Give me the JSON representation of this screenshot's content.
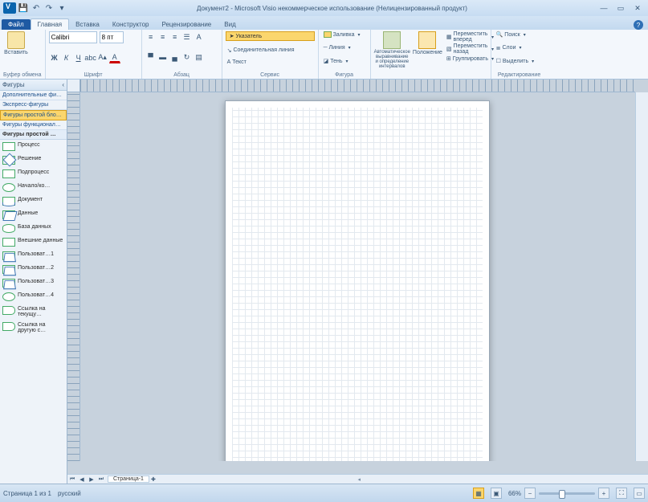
{
  "title": "Документ2 - Microsoft Visio некоммерческое использование (Нелицензированный продукт)",
  "qat": {
    "save": "💾",
    "undo": "↶",
    "redo": "↷",
    "more": "▾"
  },
  "wc": {
    "min": "—",
    "max": "▭",
    "close": "✕"
  },
  "tabs": {
    "file": "Файл",
    "items": [
      "Главная",
      "Вставка",
      "Конструктор",
      "Рецензирование",
      "Вид"
    ],
    "active": 0
  },
  "ribbon": {
    "clipboard": {
      "label": "Буфер обмена",
      "paste": "Вставить"
    },
    "font": {
      "label": "Шрифт",
      "name": "Calibri",
      "size": "8 пт"
    },
    "para": {
      "label": "Абзац"
    },
    "tools": {
      "label": "Сервис",
      "pointer": "Указатель",
      "connector": "Соединительная линия",
      "text": "Текст"
    },
    "shape": {
      "label": "Фигура",
      "fill": "Заливка",
      "line": "Линия",
      "shadow": "Тень"
    },
    "arrange": {
      "label": "",
      "auto": "Автоматическое выравнивание и определение интервалов",
      "position": "Положение",
      "front": "Переместить вперед",
      "back": "Переместить назад",
      "group": "Группировать"
    },
    "edit": {
      "label": "Редактирование",
      "find": "Поиск",
      "layers": "Слои",
      "select": "Выделить"
    }
  },
  "shapes": {
    "title": "Фигуры",
    "sections": [
      "Дополнительные фи…",
      "Экспресс-фигуры",
      "Фигуры простой бло…",
      "Фигуры функционал…"
    ],
    "activeSection": 2,
    "header": "Фигуры простой …",
    "items": [
      {
        "g": "g-rect",
        "label": "Процесс"
      },
      {
        "g": "g-diam",
        "label": "Решение"
      },
      {
        "g": "g-rect",
        "label": "Подпроцесс"
      },
      {
        "g": "g-ell",
        "label": "Начало/ко…"
      },
      {
        "g": "g-doc",
        "label": "Документ"
      },
      {
        "g": "g-para",
        "label": "Данные"
      },
      {
        "g": "g-db",
        "label": "База данных"
      },
      {
        "g": "g-rect",
        "label": "Внешние данные"
      },
      {
        "g": "g-trap",
        "label": "Пользоват…1"
      },
      {
        "g": "g-trap",
        "label": "Пользоват…2"
      },
      {
        "g": "g-trap",
        "label": "Пользоват…3"
      },
      {
        "g": "g-ell",
        "label": "Пользоват…4"
      },
      {
        "g": "g-tag",
        "label": "Ссылка на текущу…"
      },
      {
        "g": "g-tag",
        "label": "Ссылка на другую с…"
      }
    ]
  },
  "pagetab": {
    "label": "Страница-1"
  },
  "status": {
    "page": "Страница 1 из 1",
    "lang": "русский",
    "zoom": "66%",
    "minus": "−",
    "plus": "+"
  }
}
